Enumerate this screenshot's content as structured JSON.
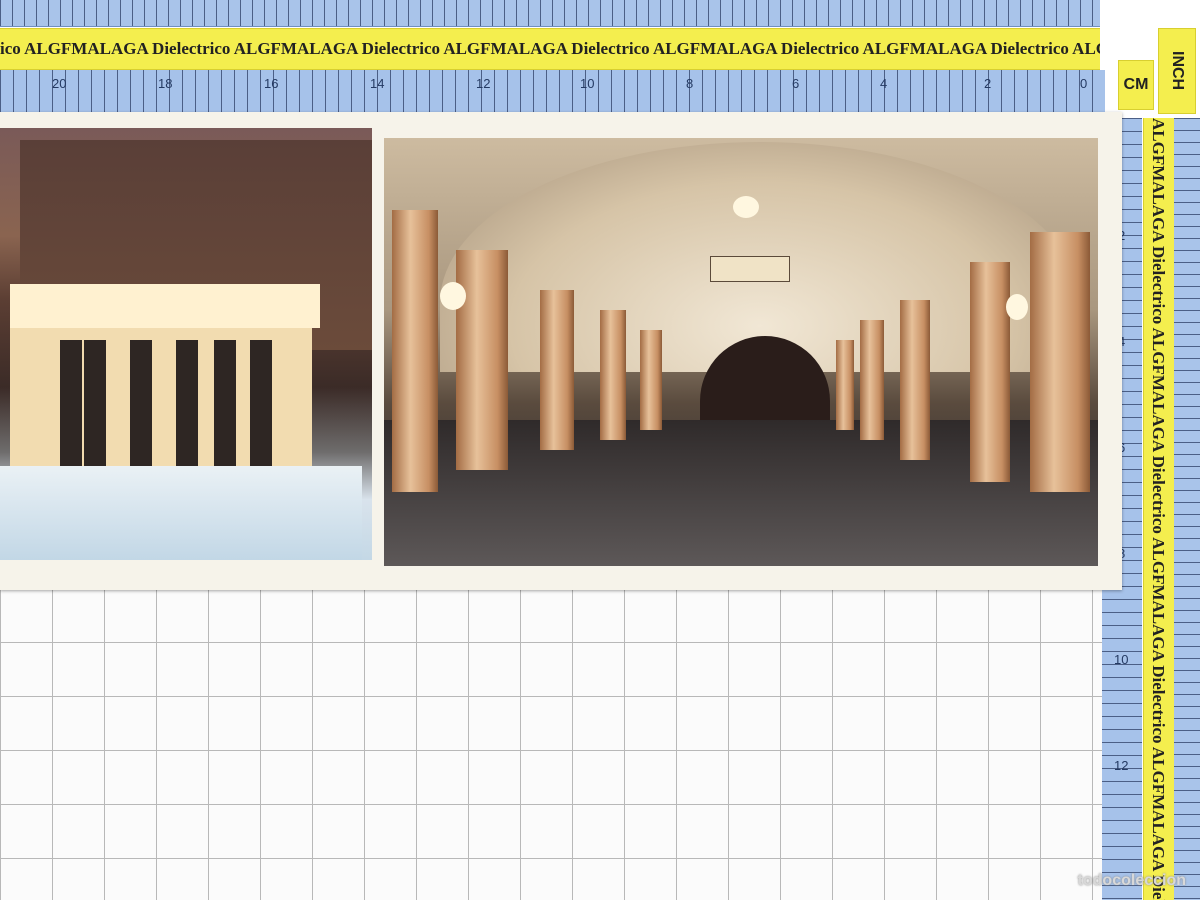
{
  "ruler": {
    "brand_text": "Dielectrico ALGFMALAGA",
    "repeat_text": "ico ALGFMALAGA Dielectrico ALGFMALAGA Dielectrico ALGFMALAGA Dielectrico ALGFMALAGA Dielectrico ALGFMALAGA Dielectrico ALGFMALAGA",
    "vertical_text": "ALGFMALAGA Dielectrico ALGFMALAGA Dielectrico ALGFMALAGA Dielectrico ALGFMALAGA Dielectric",
    "inch_label": "INCH",
    "cm_label": "CM",
    "top_numbers": [
      "20",
      "18",
      "16",
      "14",
      "12",
      "10",
      "8",
      "6",
      "4",
      "2",
      "0"
    ],
    "right_numbers": [
      "2",
      "4",
      "6",
      "8",
      "10",
      "12"
    ]
  },
  "postcard": {
    "left_photo_name": "metro entrance colonnade at night in snow",
    "right_photo_name": "metro station hall with arched ceiling"
  },
  "colors": {
    "ruler_blue": "#a6c2ea",
    "ruler_yellow": "#f4ee4e",
    "grid_line": "#b8b8b8",
    "card": "#f6f3ea"
  },
  "watermark": "todocoleccion"
}
